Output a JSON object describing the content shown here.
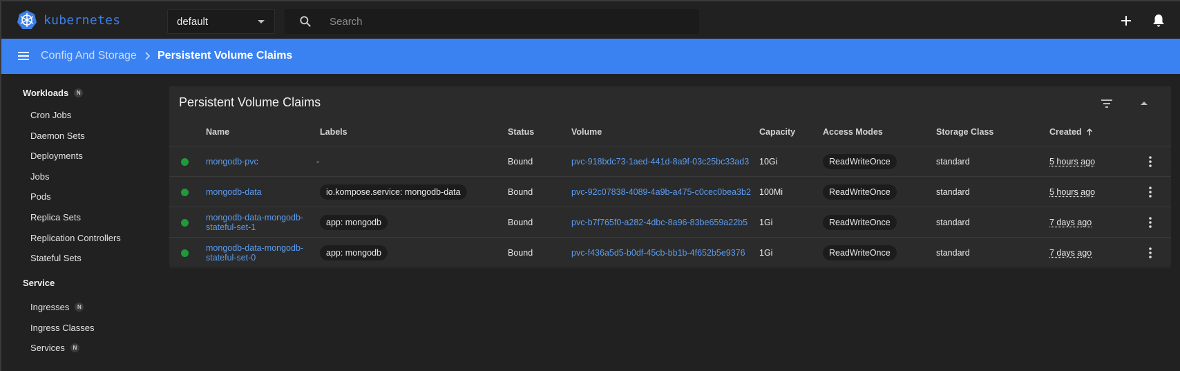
{
  "app": {
    "title": "kubernetes"
  },
  "namespace": {
    "selected": "default"
  },
  "search": {
    "placeholder": "Search"
  },
  "breadcrumb": {
    "parent": "Config And Storage",
    "current": "Persistent Volume Claims"
  },
  "sidebar": {
    "sections": [
      {
        "heading": "Workloads",
        "badge": "N",
        "items": [
          {
            "label": "Cron Jobs"
          },
          {
            "label": "Daemon Sets"
          },
          {
            "label": "Deployments"
          },
          {
            "label": "Jobs"
          },
          {
            "label": "Pods"
          },
          {
            "label": "Replica Sets"
          },
          {
            "label": "Replication Controllers"
          },
          {
            "label": "Stateful Sets"
          }
        ]
      },
      {
        "heading": "Service",
        "items": [
          {
            "label": "Ingresses",
            "badge": "N"
          },
          {
            "label": "Ingress Classes"
          },
          {
            "label": "Services",
            "badge": "N"
          }
        ]
      }
    ]
  },
  "card": {
    "title": "Persistent Volume Claims"
  },
  "table": {
    "columns": [
      "Name",
      "Labels",
      "Status",
      "Volume",
      "Capacity",
      "Access Modes",
      "Storage Class",
      "Created"
    ],
    "sort": {
      "column": "Created",
      "direction": "ascending"
    },
    "rows": [
      {
        "status_color": "#1f9a3a",
        "name_line1": "mongodb-pvc",
        "name_line2": "",
        "labels": "-",
        "labels_chip": false,
        "status": "Bound",
        "volume": "pvc-918bdc73-1aed-441d-8a9f-03c25bc33ad3",
        "capacity": "10Gi",
        "access_modes": "ReadWriteOnce",
        "storage_class": "standard",
        "created": "5 hours ago"
      },
      {
        "status_color": "#1f9a3a",
        "name_line1": "mongodb-data",
        "name_line2": "",
        "labels": "io.kompose.service: mongodb-data",
        "labels_chip": true,
        "status": "Bound",
        "volume": "pvc-92c07838-4089-4a9b-a475-c0cec0bea3b2",
        "capacity": "100Mi",
        "access_modes": "ReadWriteOnce",
        "storage_class": "standard",
        "created": "5 hours ago"
      },
      {
        "status_color": "#1f9a3a",
        "name_line1": "mongodb-data-mongodb-",
        "name_line2": "stateful-set-1",
        "labels": "app: mongodb",
        "labels_chip": true,
        "status": "Bound",
        "volume": "pvc-b7f765f0-a282-4dbc-8a96-83be659a22b5",
        "capacity": "1Gi",
        "access_modes": "ReadWriteOnce",
        "storage_class": "standard",
        "created": "7 days ago"
      },
      {
        "status_color": "#1f9a3a",
        "name_line1": "mongodb-data-mongodb-",
        "name_line2": "stateful-set-0",
        "labels": "app: mongodb",
        "labels_chip": true,
        "status": "Bound",
        "volume": "pvc-f436a5d5-b0df-45cb-bb1b-4f652b5e9376",
        "capacity": "1Gi",
        "access_modes": "ReadWriteOnce",
        "storage_class": "standard",
        "created": "7 days ago"
      }
    ]
  },
  "icons": [
    "kubernetes-logo-icon",
    "search-icon",
    "add-icon",
    "bell-icon",
    "menu-icon",
    "chevron-right-icon",
    "filter-icon",
    "collapse-icon",
    "sort-arrow-up-icon",
    "more-vert-icon"
  ]
}
